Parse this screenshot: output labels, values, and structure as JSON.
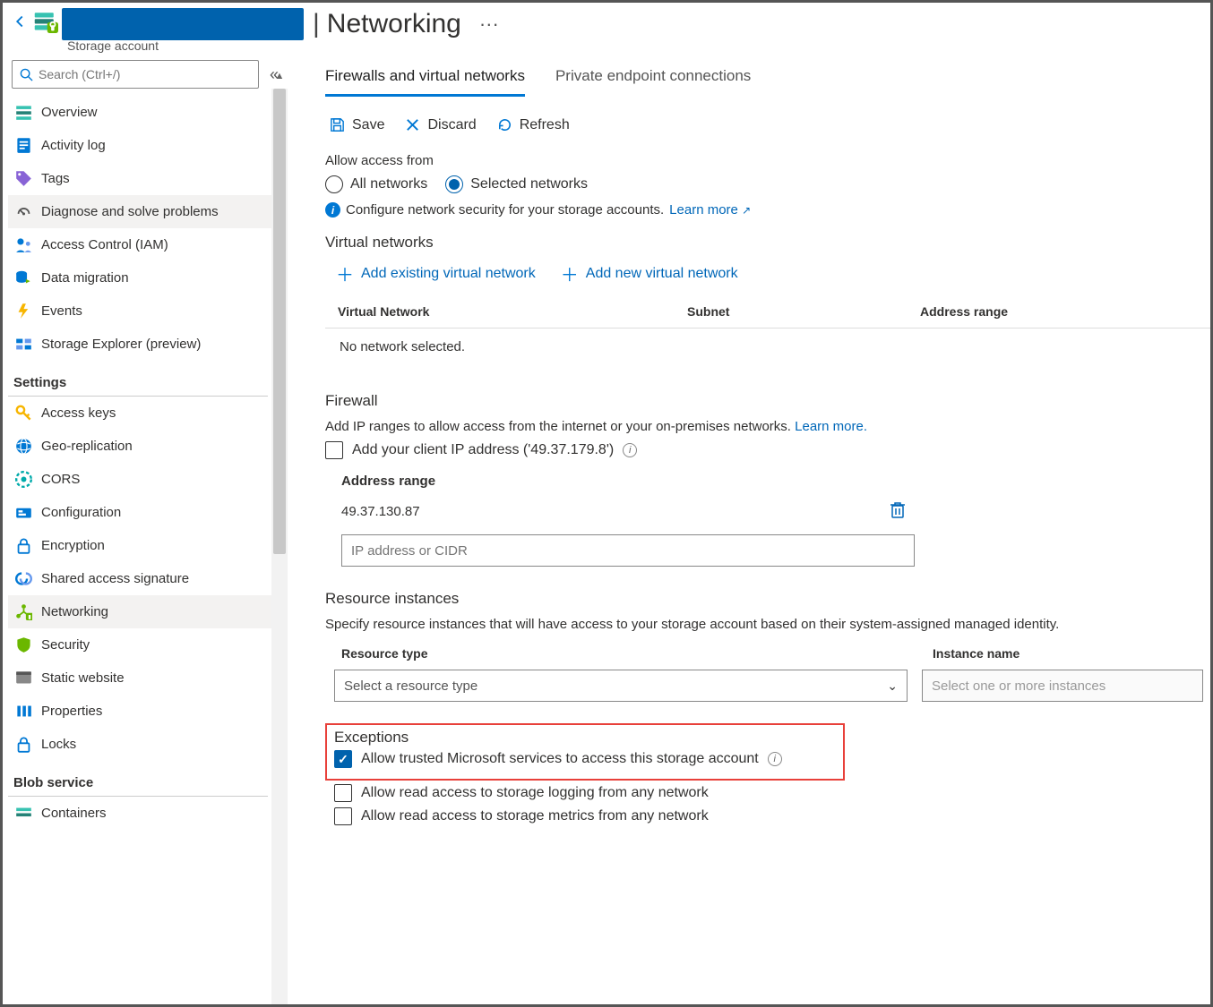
{
  "header": {
    "page_title": "Networking",
    "subtitle": "Storage account",
    "more": "···"
  },
  "sidebar": {
    "search_placeholder": "Search (Ctrl+/)",
    "groups": {
      "settings": "Settings",
      "blob": "Blob service"
    },
    "items": {
      "overview": "Overview",
      "activity": "Activity log",
      "tags": "Tags",
      "diagnose": "Diagnose and solve problems",
      "iam": "Access Control (IAM)",
      "datamig": "Data migration",
      "events": "Events",
      "explorer": "Storage Explorer (preview)",
      "accesskeys": "Access keys",
      "georep": "Geo-replication",
      "cors": "CORS",
      "config": "Configuration",
      "encryption": "Encryption",
      "sas": "Shared access signature",
      "networking": "Networking",
      "security": "Security",
      "staticweb": "Static website",
      "properties": "Properties",
      "locks": "Locks",
      "containers": "Containers"
    }
  },
  "tabs": {
    "firewalls": "Firewalls and virtual networks",
    "private": "Private endpoint connections"
  },
  "toolbar": {
    "save": "Save",
    "discard": "Discard",
    "refresh": "Refresh"
  },
  "access": {
    "label": "Allow access from",
    "all": "All networks",
    "selected": "Selected networks",
    "info": "Configure network security for your storage accounts.",
    "learn": "Learn more"
  },
  "vnet": {
    "heading": "Virtual networks",
    "add_existing": "Add existing virtual network",
    "add_new": "Add new virtual network",
    "col_vn": "Virtual Network",
    "col_subnet": "Subnet",
    "col_range": "Address range",
    "empty": "No network selected."
  },
  "firewall": {
    "heading": "Firewall",
    "desc": "Add IP ranges to allow access from the internet or your on-premises networks.",
    "learn": "Learn more.",
    "add_client": "Add your client IP address ('49.37.179.8')",
    "col_range": "Address range",
    "ip_value": "49.37.130.87",
    "ip_placeholder": "IP address or CIDR"
  },
  "resinst": {
    "heading": "Resource instances",
    "desc": "Specify resource instances that will have access to your storage account based on their system-assigned managed identity.",
    "col_type": "Resource type",
    "col_name": "Instance name",
    "type_placeholder": "Select a resource type",
    "name_placeholder": "Select one or more instances"
  },
  "exceptions": {
    "heading": "Exceptions",
    "trusted": "Allow trusted Microsoft services to access this storage account",
    "logging": "Allow read access to storage logging from any network",
    "metrics": "Allow read access to storage metrics from any network"
  }
}
